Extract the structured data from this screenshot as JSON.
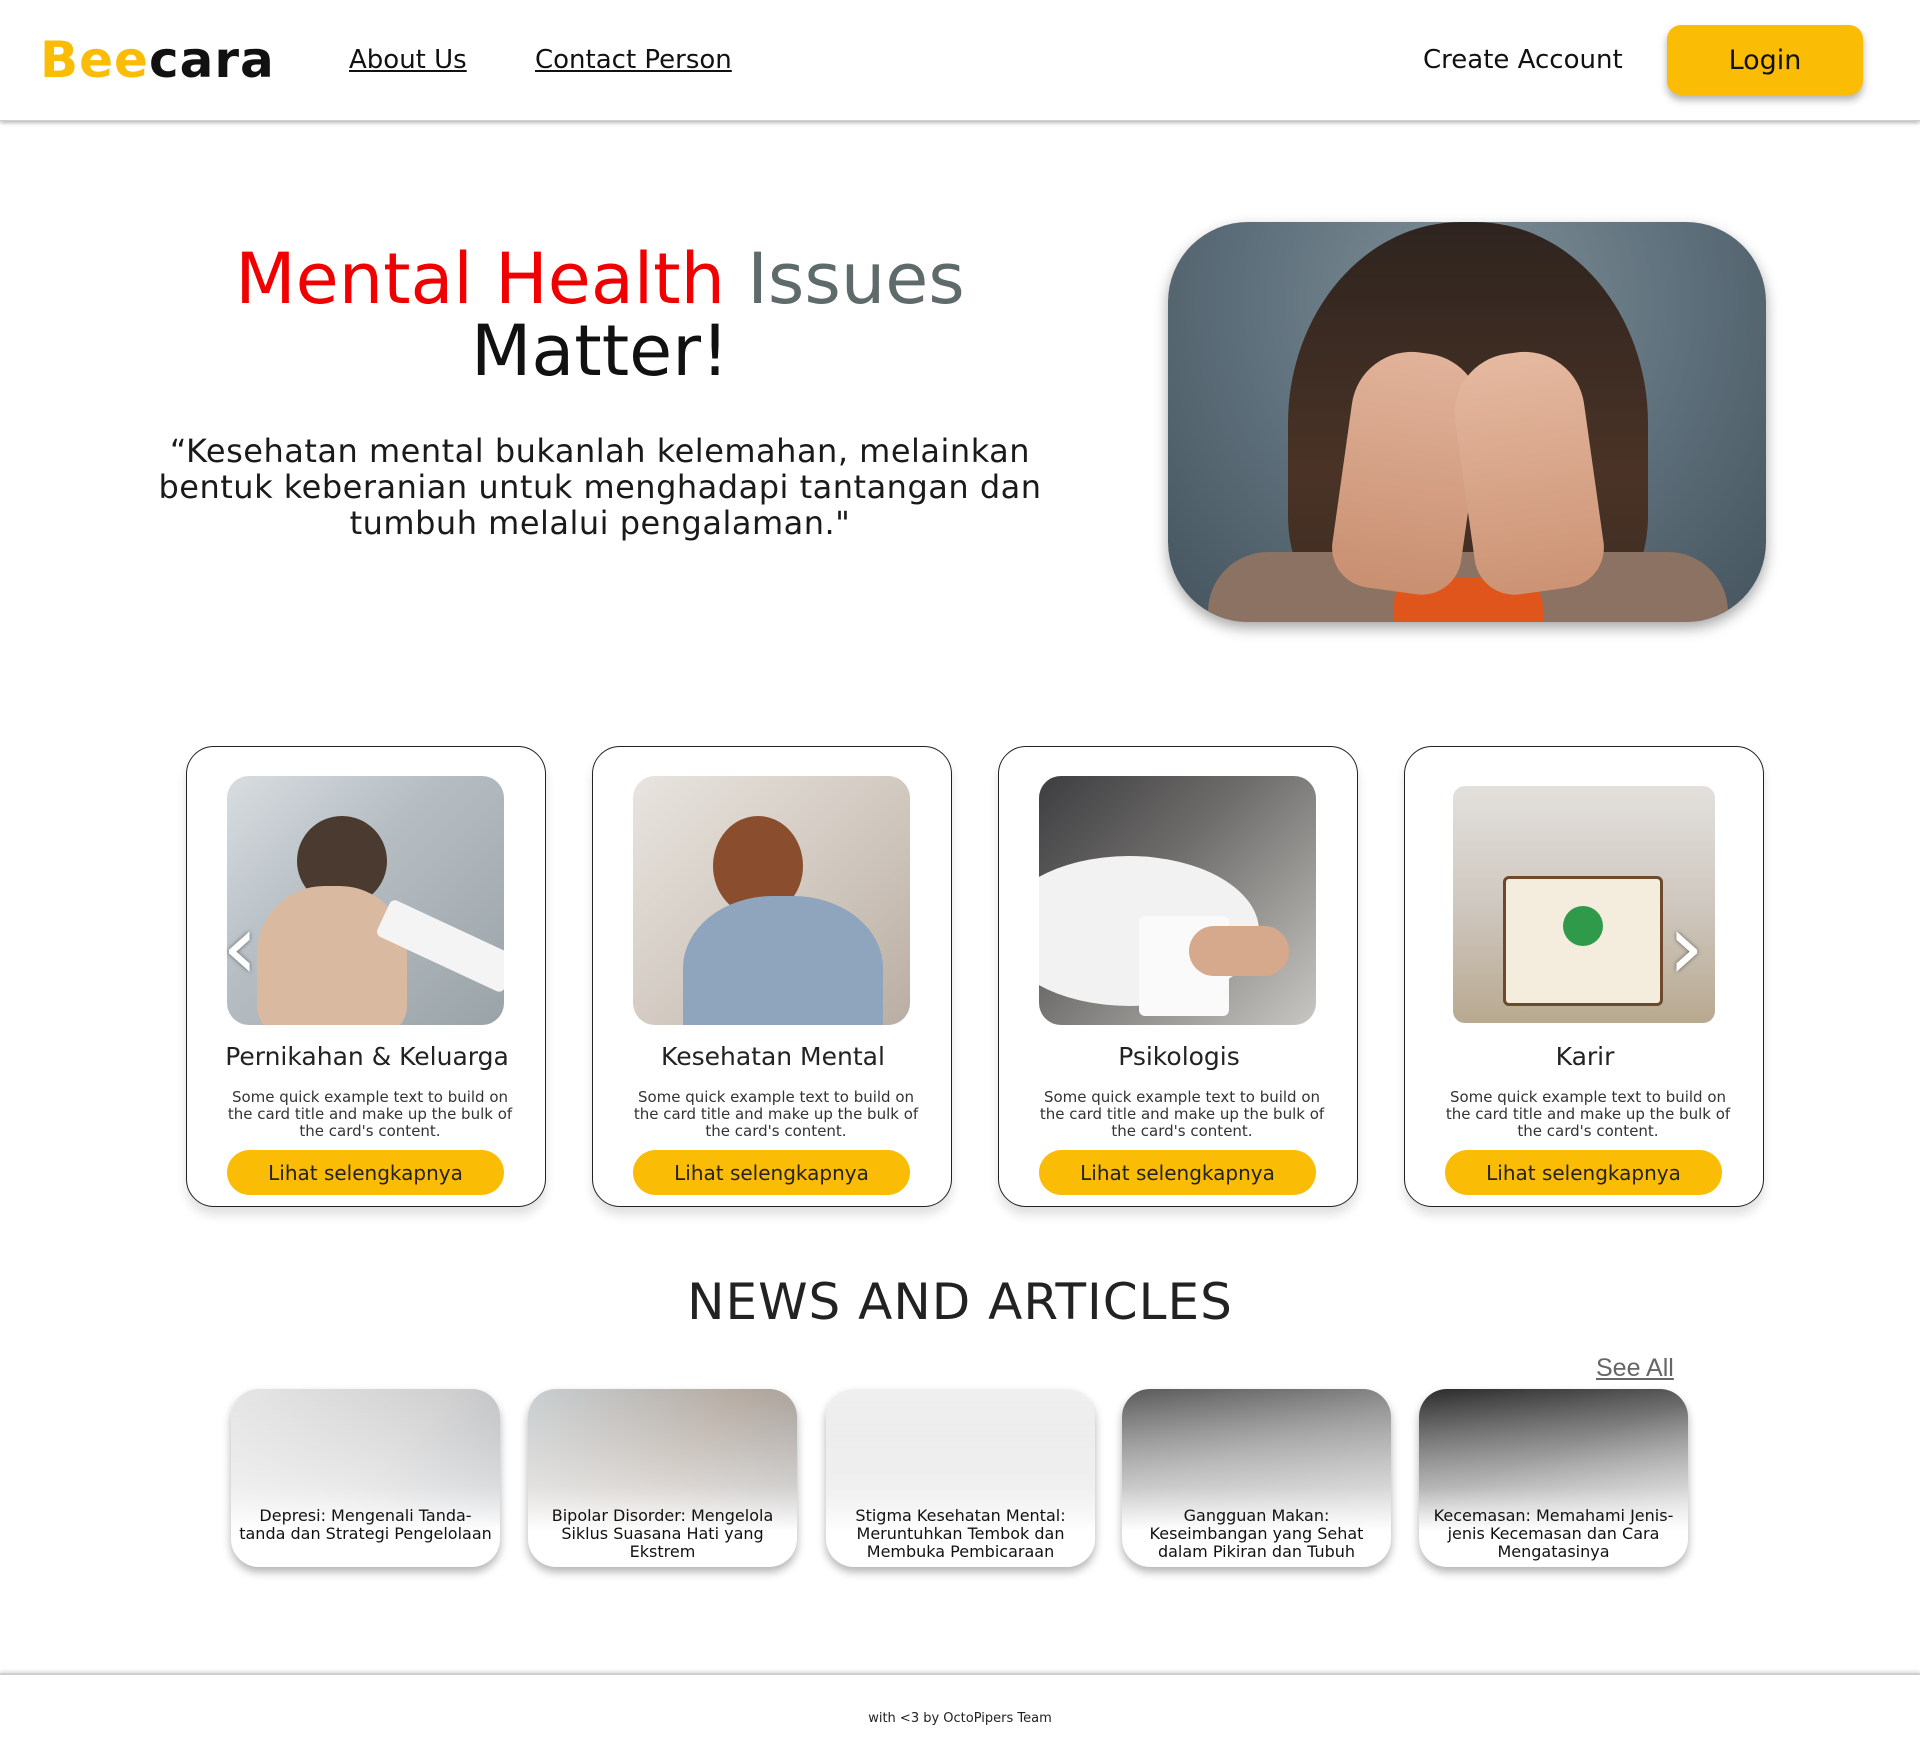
{
  "nav": {
    "logo_part1": "Bee",
    "logo_part2": "cara",
    "links": [
      "About Us",
      "Contact Person"
    ],
    "create_account": "Create Account",
    "login": "Login"
  },
  "hero": {
    "title_part1": "Mental Health",
    "title_part2": "Issues",
    "title_part3": "Matter!",
    "quote": "“Kesehatan mental bukanlah kelemahan, melainkan bentuk keberanian untuk menghadapi tantangan dan tumbuh melalui pengalaman.\""
  },
  "categories": [
    {
      "title": "Pernikahan & Keluarga",
      "text": "Some quick example text to build on the card title and make up the bulk of the card's content.",
      "button": "Lihat selengkapnya"
    },
    {
      "title": "Kesehatan Mental",
      "text": "Some quick example text to build on the card title and make up the bulk of the card's content.",
      "button": "Lihat selengkapnya"
    },
    {
      "title": "Psikologis",
      "text": "Some quick example text to build on the card title and make up the bulk of the card's content.",
      "button": "Lihat selengkapnya"
    },
    {
      "title": "Karir",
      "text": "Some quick example text to build on the card title and make up the bulk of the card's content.",
      "button": "Lihat selengkapnya"
    }
  ],
  "carousel": {
    "prev_icon": "chevron-left-icon",
    "next_icon": "chevron-right-icon"
  },
  "news": {
    "heading": "NEWS AND ARTICLES",
    "see_all": "See All",
    "articles": [
      {
        "title": "Depresi: Mengenali Tanda-tanda dan Strategi Pengelolaan"
      },
      {
        "title": "Bipolar Disorder: Mengelola Siklus Suasana Hati yang Ekstrem"
      },
      {
        "title": "Stigma Kesehatan Mental: Meruntuhkan Tembok dan Membuka Pembicaraan"
      },
      {
        "title": "Gangguan Makan: Keseimbangan yang Sehat dalam Pikiran dan Tubuh"
      },
      {
        "title": "Kecemasan: Memahami Jenis-jenis Kecemasan dan Cara Mengatasinya"
      }
    ]
  },
  "footer": {
    "text": "with <3 by OctoPipers Team"
  },
  "colors": {
    "accent": "#FBBC05",
    "hero_red": "#F00000",
    "hero_gray": "#5f6a6a"
  }
}
